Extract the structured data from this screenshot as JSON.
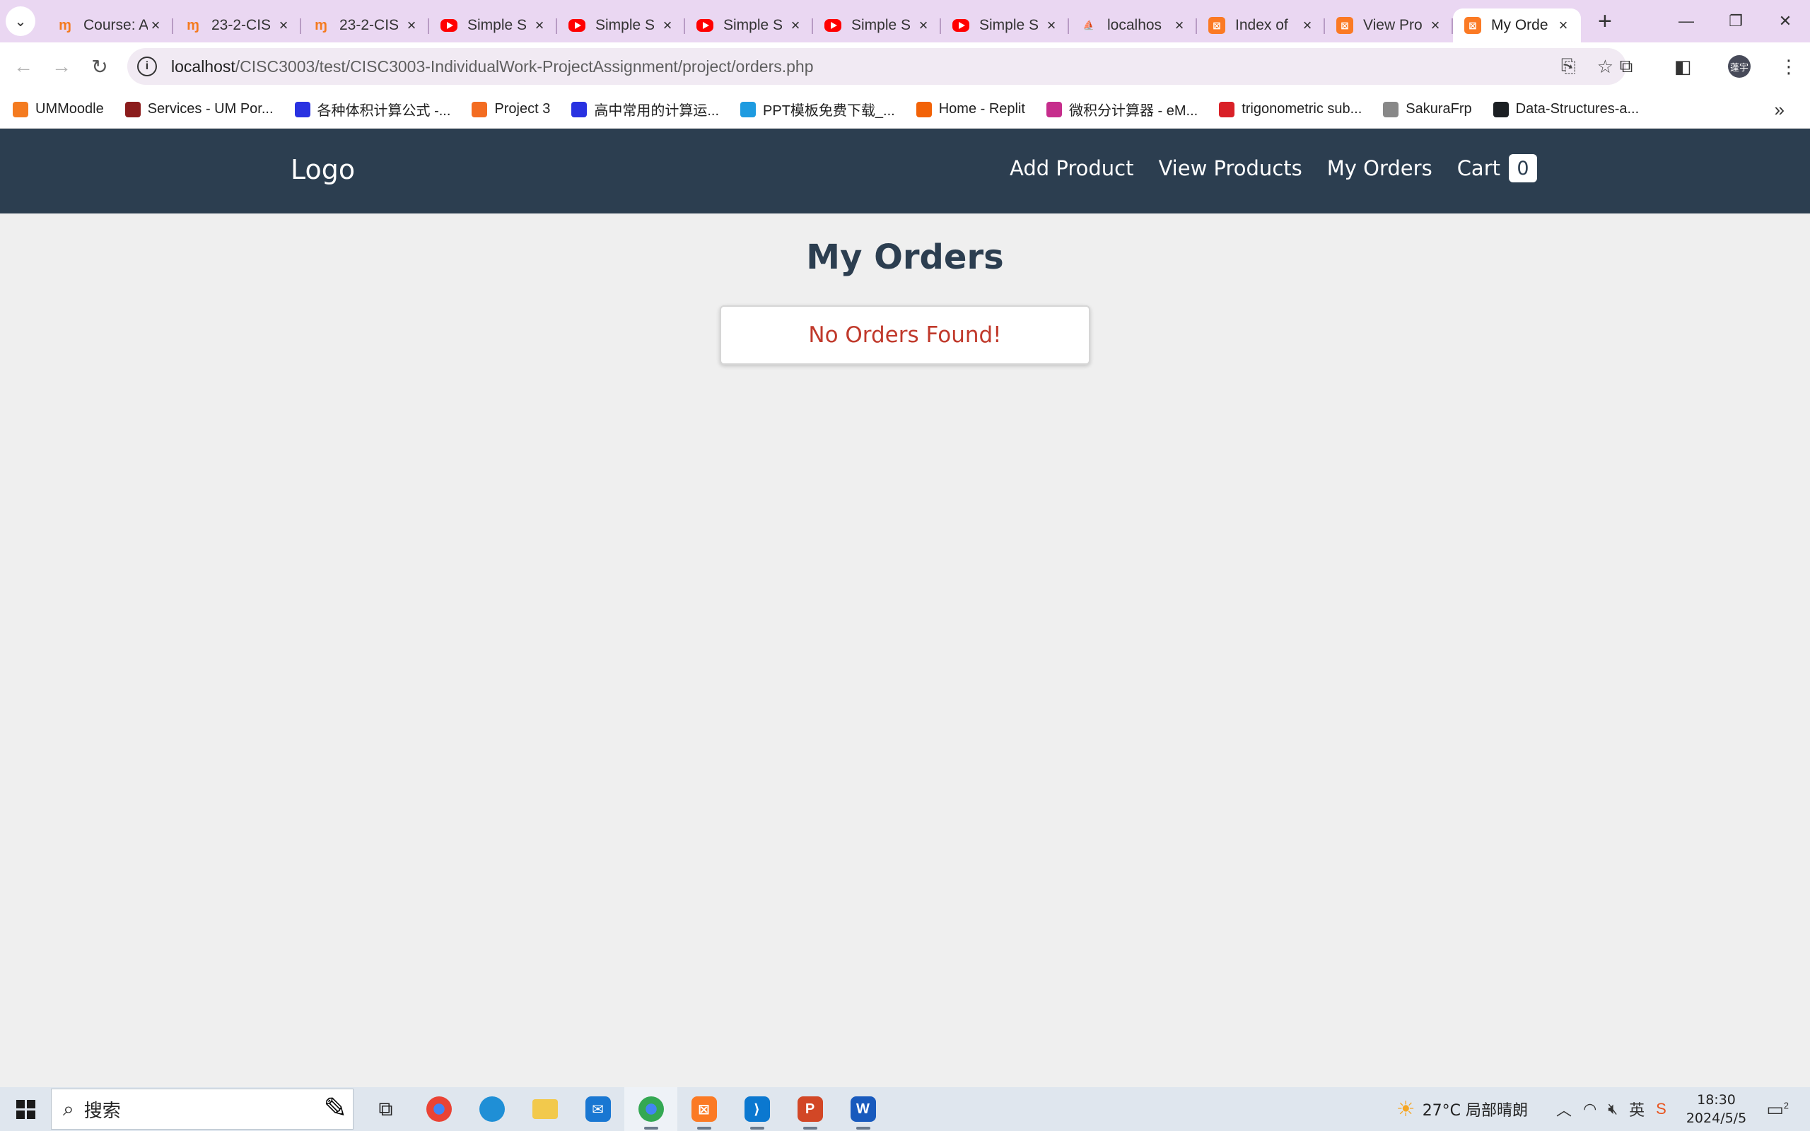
{
  "browser": {
    "tabs": [
      {
        "title": "Course: A",
        "favicon": "moodle-icon",
        "active": false
      },
      {
        "title": "23-2-CIS",
        "favicon": "moodle-icon",
        "active": false
      },
      {
        "title": "23-2-CIS",
        "favicon": "moodle-icon",
        "active": false
      },
      {
        "title": "Simple S",
        "favicon": "youtube-icon",
        "active": false
      },
      {
        "title": "Simple S",
        "favicon": "youtube-icon",
        "active": false
      },
      {
        "title": "Simple S",
        "favicon": "youtube-icon",
        "active": false
      },
      {
        "title": "Simple S",
        "favicon": "youtube-icon",
        "active": false
      },
      {
        "title": "Simple S",
        "favicon": "youtube-icon",
        "active": false
      },
      {
        "title": "localhos",
        "favicon": "phpmyadmin-icon",
        "active": false
      },
      {
        "title": "Index of",
        "favicon": "xampp-icon",
        "active": false
      },
      {
        "title": "View Pro",
        "favicon": "xampp-icon",
        "active": false
      },
      {
        "title": "My Orde",
        "favicon": "xampp-icon",
        "active": true
      }
    ],
    "url_host": "localhost",
    "url_path": "/CISC3003/test/CISC3003-IndividualWork-ProjectAssignment/project/orders.php",
    "profile_initials": "蓬宇",
    "bookmarks": [
      {
        "label": "UMMoodle",
        "icon": "moodle-icon",
        "color": "#f47b20"
      },
      {
        "label": "Services - UM Por...",
        "icon": "um-icon",
        "color": "#8b1c1c"
      },
      {
        "label": "各种体积计算公式 -...",
        "icon": "baidu-icon",
        "color": "#2932e1"
      },
      {
        "label": "Project 3",
        "icon": "bell-icon",
        "color": "#f36c21"
      },
      {
        "label": "高中常用的计算运...",
        "icon": "baidu-icon",
        "color": "#2932e1"
      },
      {
        "label": "PPT模板免费下载_...",
        "icon": "youpin-icon",
        "color": "#1e9be0"
      },
      {
        "label": "Home - Replit",
        "icon": "replit-icon",
        "color": "#f26207"
      },
      {
        "label": "微积分计算器 - eM...",
        "icon": "emath-icon",
        "color": "#c62d8c"
      },
      {
        "label": "trigonometric sub...",
        "icon": "symbolab-icon",
        "color": "#d92027"
      },
      {
        "label": "SakuraFrp",
        "icon": "sakura-icon",
        "color": "#888888"
      },
      {
        "label": "Data-Structures-a...",
        "icon": "github-icon",
        "color": "#1b1f23"
      }
    ]
  },
  "site": {
    "logo": "Logo",
    "nav": {
      "add_product": "Add Product",
      "view_products": "View Products",
      "my_orders": "My Orders",
      "cart": "Cart",
      "cart_count": "0"
    },
    "page_title": "My Orders",
    "empty_message": "No Orders Found!",
    "colors": {
      "navbar": "#2c3e50",
      "title": "#2c3e50",
      "message": "#c0392b",
      "background": "#efefef"
    }
  },
  "taskbar": {
    "search_placeholder": "搜索",
    "weather": "27°C 局部晴朗",
    "time": "18:30",
    "date": "2024/5/5",
    "notification_count": "2"
  }
}
